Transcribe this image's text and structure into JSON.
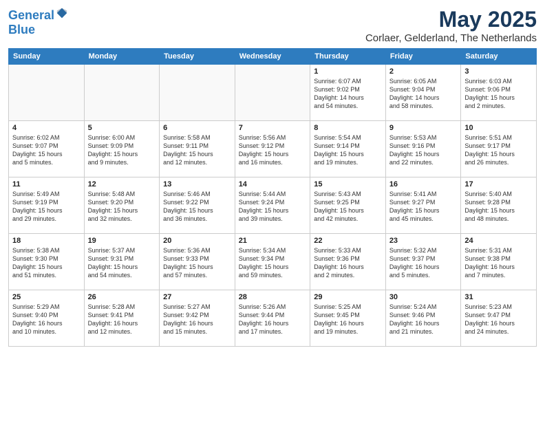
{
  "logo": {
    "line1": "General",
    "line2": "Blue"
  },
  "title": "May 2025",
  "location": "Corlaer, Gelderland, The Netherlands",
  "days_of_week": [
    "Sunday",
    "Monday",
    "Tuesday",
    "Wednesday",
    "Thursday",
    "Friday",
    "Saturday"
  ],
  "weeks": [
    [
      {
        "day": "",
        "info": ""
      },
      {
        "day": "",
        "info": ""
      },
      {
        "day": "",
        "info": ""
      },
      {
        "day": "",
        "info": ""
      },
      {
        "day": "1",
        "info": "Sunrise: 6:07 AM\nSunset: 9:02 PM\nDaylight: 14 hours\nand 54 minutes."
      },
      {
        "day": "2",
        "info": "Sunrise: 6:05 AM\nSunset: 9:04 PM\nDaylight: 14 hours\nand 58 minutes."
      },
      {
        "day": "3",
        "info": "Sunrise: 6:03 AM\nSunset: 9:06 PM\nDaylight: 15 hours\nand 2 minutes."
      }
    ],
    [
      {
        "day": "4",
        "info": "Sunrise: 6:02 AM\nSunset: 9:07 PM\nDaylight: 15 hours\nand 5 minutes."
      },
      {
        "day": "5",
        "info": "Sunrise: 6:00 AM\nSunset: 9:09 PM\nDaylight: 15 hours\nand 9 minutes."
      },
      {
        "day": "6",
        "info": "Sunrise: 5:58 AM\nSunset: 9:11 PM\nDaylight: 15 hours\nand 12 minutes."
      },
      {
        "day": "7",
        "info": "Sunrise: 5:56 AM\nSunset: 9:12 PM\nDaylight: 15 hours\nand 16 minutes."
      },
      {
        "day": "8",
        "info": "Sunrise: 5:54 AM\nSunset: 9:14 PM\nDaylight: 15 hours\nand 19 minutes."
      },
      {
        "day": "9",
        "info": "Sunrise: 5:53 AM\nSunset: 9:16 PM\nDaylight: 15 hours\nand 22 minutes."
      },
      {
        "day": "10",
        "info": "Sunrise: 5:51 AM\nSunset: 9:17 PM\nDaylight: 15 hours\nand 26 minutes."
      }
    ],
    [
      {
        "day": "11",
        "info": "Sunrise: 5:49 AM\nSunset: 9:19 PM\nDaylight: 15 hours\nand 29 minutes."
      },
      {
        "day": "12",
        "info": "Sunrise: 5:48 AM\nSunset: 9:20 PM\nDaylight: 15 hours\nand 32 minutes."
      },
      {
        "day": "13",
        "info": "Sunrise: 5:46 AM\nSunset: 9:22 PM\nDaylight: 15 hours\nand 36 minutes."
      },
      {
        "day": "14",
        "info": "Sunrise: 5:44 AM\nSunset: 9:24 PM\nDaylight: 15 hours\nand 39 minutes."
      },
      {
        "day": "15",
        "info": "Sunrise: 5:43 AM\nSunset: 9:25 PM\nDaylight: 15 hours\nand 42 minutes."
      },
      {
        "day": "16",
        "info": "Sunrise: 5:41 AM\nSunset: 9:27 PM\nDaylight: 15 hours\nand 45 minutes."
      },
      {
        "day": "17",
        "info": "Sunrise: 5:40 AM\nSunset: 9:28 PM\nDaylight: 15 hours\nand 48 minutes."
      }
    ],
    [
      {
        "day": "18",
        "info": "Sunrise: 5:38 AM\nSunset: 9:30 PM\nDaylight: 15 hours\nand 51 minutes."
      },
      {
        "day": "19",
        "info": "Sunrise: 5:37 AM\nSunset: 9:31 PM\nDaylight: 15 hours\nand 54 minutes."
      },
      {
        "day": "20",
        "info": "Sunrise: 5:36 AM\nSunset: 9:33 PM\nDaylight: 15 hours\nand 57 minutes."
      },
      {
        "day": "21",
        "info": "Sunrise: 5:34 AM\nSunset: 9:34 PM\nDaylight: 15 hours\nand 59 minutes."
      },
      {
        "day": "22",
        "info": "Sunrise: 5:33 AM\nSunset: 9:36 PM\nDaylight: 16 hours\nand 2 minutes."
      },
      {
        "day": "23",
        "info": "Sunrise: 5:32 AM\nSunset: 9:37 PM\nDaylight: 16 hours\nand 5 minutes."
      },
      {
        "day": "24",
        "info": "Sunrise: 5:31 AM\nSunset: 9:38 PM\nDaylight: 16 hours\nand 7 minutes."
      }
    ],
    [
      {
        "day": "25",
        "info": "Sunrise: 5:29 AM\nSunset: 9:40 PM\nDaylight: 16 hours\nand 10 minutes."
      },
      {
        "day": "26",
        "info": "Sunrise: 5:28 AM\nSunset: 9:41 PM\nDaylight: 16 hours\nand 12 minutes."
      },
      {
        "day": "27",
        "info": "Sunrise: 5:27 AM\nSunset: 9:42 PM\nDaylight: 16 hours\nand 15 minutes."
      },
      {
        "day": "28",
        "info": "Sunrise: 5:26 AM\nSunset: 9:44 PM\nDaylight: 16 hours\nand 17 minutes."
      },
      {
        "day": "29",
        "info": "Sunrise: 5:25 AM\nSunset: 9:45 PM\nDaylight: 16 hours\nand 19 minutes."
      },
      {
        "day": "30",
        "info": "Sunrise: 5:24 AM\nSunset: 9:46 PM\nDaylight: 16 hours\nand 21 minutes."
      },
      {
        "day": "31",
        "info": "Sunrise: 5:23 AM\nSunset: 9:47 PM\nDaylight: 16 hours\nand 24 minutes."
      }
    ]
  ]
}
